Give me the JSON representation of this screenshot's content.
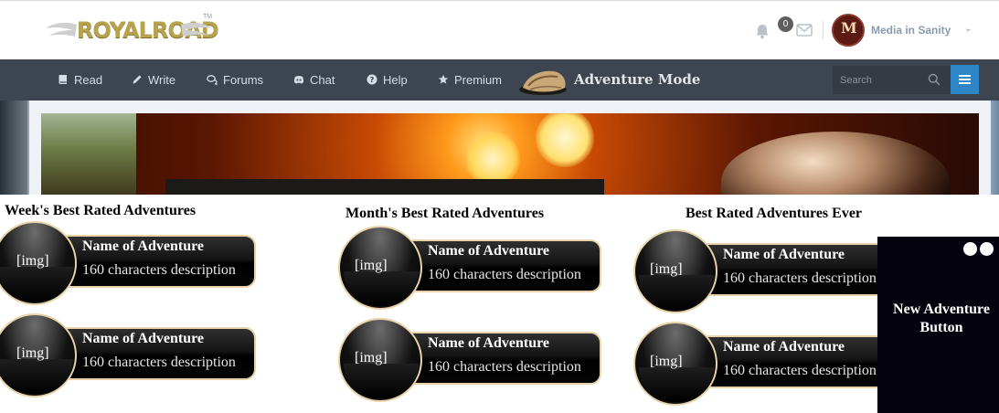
{
  "header": {
    "logo_text": "ROYALROAD",
    "logo_tm": "TM",
    "notification_count": "0",
    "avatar_initials": "M",
    "username": "Media in Sanity"
  },
  "nav": {
    "items": [
      {
        "label": "Read",
        "icon": "book-icon"
      },
      {
        "label": "Write",
        "icon": "pencil-icon"
      },
      {
        "label": "Forums",
        "icon": "comments-icon"
      },
      {
        "label": "Chat",
        "icon": "discord-icon"
      },
      {
        "label": "Help",
        "icon": "question-circle-icon"
      },
      {
        "label": "Premium",
        "icon": "star-icon"
      }
    ],
    "adventure_mode": "Adventure Mode",
    "search_placeholder": "Search"
  },
  "sections": [
    {
      "title": "Week's Best Rated Adventures",
      "cards": [
        {
          "img": "[img]",
          "name": "Name of Adventure",
          "desc": "160 characters description"
        },
        {
          "img": "[img]",
          "name": "Name of Adventure",
          "desc": "160 characters description"
        }
      ]
    },
    {
      "title": "Month's Best Rated Adventures",
      "cards": [
        {
          "img": "[img]",
          "name": "Name of Adventure",
          "desc": "160 characters description"
        },
        {
          "img": "[img]",
          "name": "Name of Adventure",
          "desc": "160 characters description"
        }
      ]
    },
    {
      "title": "Best Rated Adventures Ever",
      "cards": [
        {
          "img": "[img]",
          "name": "Name of Adventure",
          "desc": "160 characters description"
        },
        {
          "img": "[img]",
          "name": "Name of Adventure",
          "desc": "160 characters description"
        }
      ]
    }
  ],
  "new_adventure_button": {
    "label": "New Adventure Button"
  },
  "colors": {
    "navbar": "#3d4550",
    "accent": "#2e86c6",
    "card_border": "#e7d3a7",
    "logo_gold": "#b7a24e"
  }
}
